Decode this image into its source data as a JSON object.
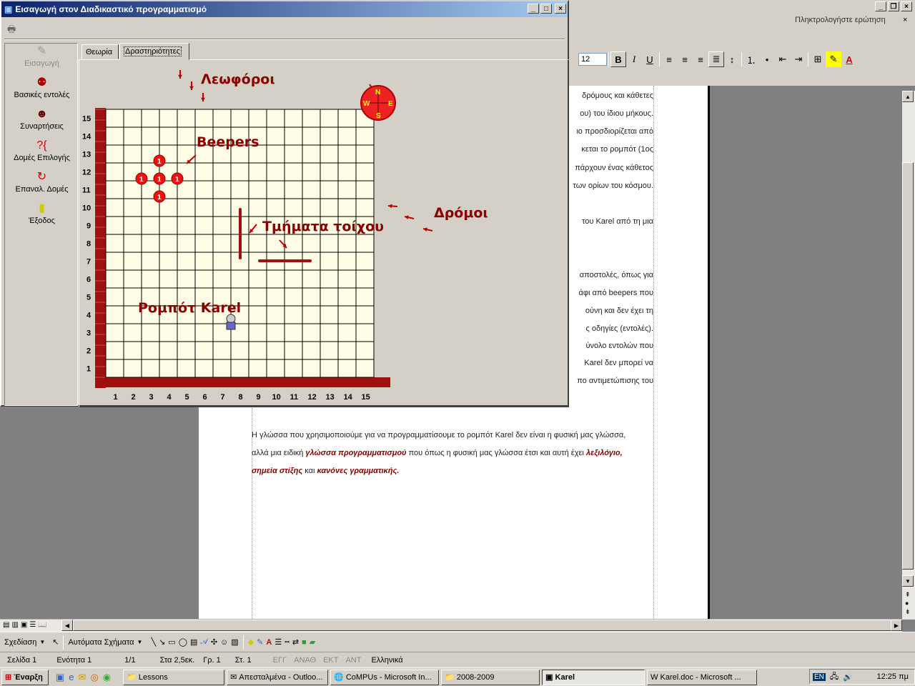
{
  "app": {
    "title": "Εισαγωγή στον Διαδικαστικό προγραμματισμό",
    "sidebar": [
      {
        "icon": "pencil-icon",
        "label": "Εισαγωγή",
        "disabled": true
      },
      {
        "icon": "robot-icon",
        "label": "Βασικές εντολές"
      },
      {
        "icon": "face-icon",
        "label": "Συναρτήσεις"
      },
      {
        "icon": "question-brace-icon",
        "label": "Δομές Επιλογής"
      },
      {
        "icon": "loop-icon",
        "label": "Επαναλ. Δομές"
      },
      {
        "icon": "exit-door-icon",
        "label": "Έξοδος"
      }
    ],
    "tabs": [
      {
        "label": "Θεωρία"
      },
      {
        "label": "Δραστηριότητες",
        "active": true
      }
    ],
    "diagram": {
      "avenues_label": "Λεωφόροι",
      "beepers_label": "Beepers",
      "streets_label": "Δρόμοι",
      "walls_label": "Τμήματα τοίχου",
      "robot_label": "Ρομπότ Karel",
      "x_ticks": [
        "1",
        "2",
        "3",
        "4",
        "5",
        "6",
        "7",
        "8",
        "9",
        "10",
        "11",
        "12",
        "13",
        "14",
        "15"
      ],
      "y_ticks": [
        "1",
        "2",
        "3",
        "4",
        "5",
        "6",
        "7",
        "8",
        "9",
        "10",
        "11",
        "12",
        "13",
        "14",
        "15"
      ],
      "compass": {
        "n": "N",
        "s": "S",
        "e": "E",
        "w": "W"
      },
      "beeper_count": "1",
      "colors": {
        "wall": "#a01010",
        "beeper": "#ee1111",
        "grid_bg": "#fffde6",
        "text": "#8b0000"
      }
    }
  },
  "word": {
    "ask_placeholder": "Πληκτρολογήστε ερώτηση",
    "font_size": "12",
    "doc_lines_right": [
      "δρόμους και κάθετες",
      "ου) του ίδιου μήκους.",
      "ιο προσδιορίζεται από",
      "κεται το ρομπότ (1ος",
      "πάρχουν ένας κάθετος",
      "των ορίων του κόσμου.",
      "του Karel από τη μια",
      "αποστολές, όπως για",
      "άφι από beepers που",
      "ούνη και δεν έχει τη",
      "ς οδηγίες (εντολές).",
      "ύνολο εντολών που",
      "Karel δεν μπορεί να",
      "πο αντιμετώπισης του"
    ],
    "para1_a": "Η γλώσσα που χρησιμοποιούμε για να προγραμματίσουμε το ρομπότ Karel δεν είναι η φυσική μας γλώσσα,",
    "para2_a": "αλλά μια ειδική",
    "para2_b": "γλώσσα προγραμματισμού",
    "para2_c": "που όπως η φυσική μας γλώσσα έτσι και αυτή έχει",
    "para2_d": "λεξιλόγιο,",
    "para3_a": "σημεία στίξης",
    "para3_b": "και",
    "para3_c": "κανόνες γραμματικής.",
    "drawing": {
      "draw": "Σχεδίαση",
      "autoshapes": "Αυτόματα Σχήματα"
    },
    "status": {
      "page": "Σελίδα 1",
      "section": "Ενότητα 1",
      "pages": "1/1",
      "at": "Στα 2,5εκ.",
      "ln": "Γρ. 1",
      "col": "Στ. 1",
      "rec": "ΕΓΓ",
      "trk": "ΑΝΑΘ",
      "ext": "ΕΚΤ",
      "ovr": "ΑΝΤ",
      "lang": "Ελληνικά"
    }
  },
  "taskbar": {
    "start": "Έναρξη",
    "tasks": [
      {
        "label": "Lessons"
      },
      {
        "label": "Απεσταλμένα - Outloo..."
      },
      {
        "label": "CoMPUs - Microsoft In..."
      },
      {
        "label": "2008-2009"
      },
      {
        "label": "Karel",
        "active": true
      },
      {
        "label": "Karel.doc - Microsoft ..."
      }
    ],
    "lang": "EN",
    "clock": "12:25 πμ"
  }
}
